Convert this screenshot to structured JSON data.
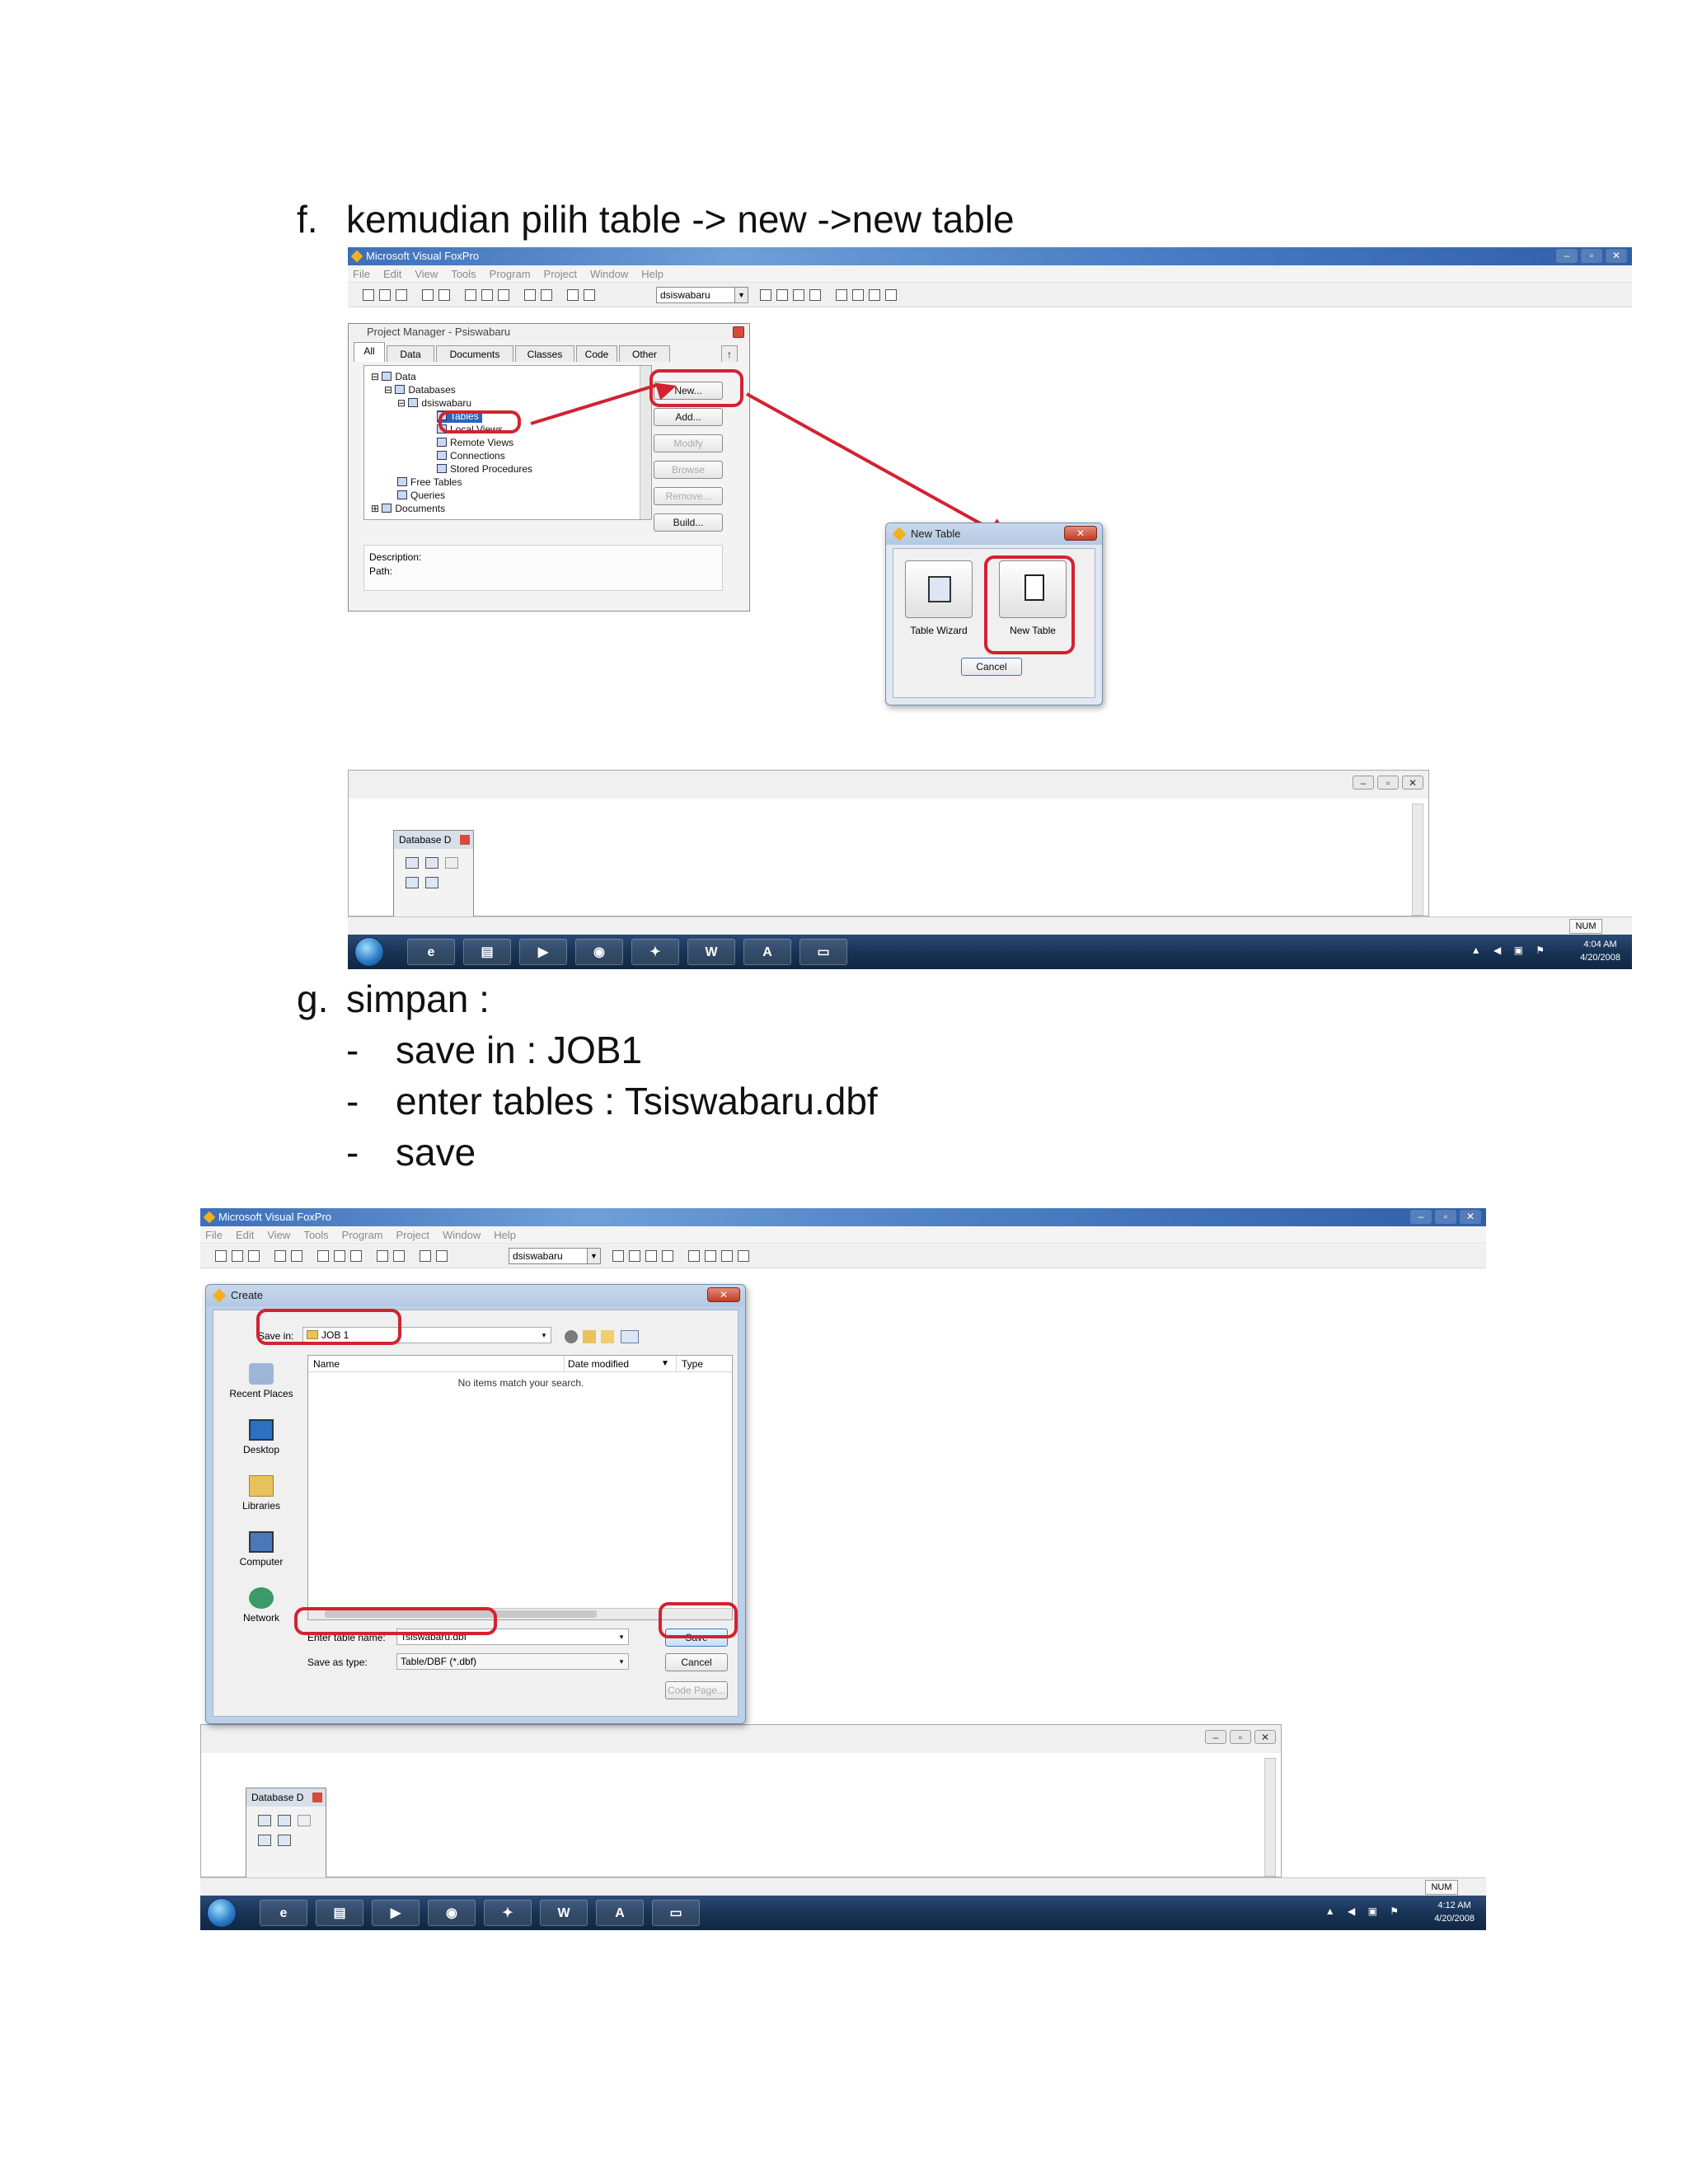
{
  "step_f": {
    "mark": "f.",
    "text": "kemudian pilih table -> new ->new table"
  },
  "step_g": {
    "mark": "g.",
    "text": "simpan :",
    "bullets": [
      "save in : JOB1",
      "enter tables : Tsiswabaru.dbf",
      "save"
    ]
  },
  "shot1": {
    "app_title": "Microsoft Visual FoxPro",
    "menu": [
      "File",
      "Edit",
      "View",
      "Tools",
      "Program",
      "Project",
      "Window",
      "Help"
    ],
    "db_combo": "dsiswabaru",
    "pm_title": "Project Manager - Psiswabaru",
    "tabs": [
      "All",
      "Data",
      "Documents",
      "Classes",
      "Code",
      "Other"
    ],
    "tree": [
      "Data",
      "Databases",
      "dsiswabaru",
      "Tables",
      "Local Views",
      "Remote Views",
      "Connections",
      "Stored Procedures",
      "Free Tables",
      "Queries",
      "Documents"
    ],
    "buttons": [
      "New...",
      "Add...",
      "Modify",
      "Browse",
      "Remove...",
      "Build..."
    ],
    "description_label": "Description:",
    "path_label": "Path:",
    "new_table_dialog": {
      "title": "New Table",
      "wizard_label": "Table Wizard",
      "new_label": "New Table",
      "cancel": "Cancel"
    },
    "db_window_title": "Database D",
    "num": "NUM",
    "clock_time": "4:04 AM",
    "clock_date": "4/20/2008"
  },
  "shot2": {
    "app_title": "Microsoft Visual FoxPro",
    "menu": [
      "File",
      "Edit",
      "View",
      "Tools",
      "Program",
      "Project",
      "Window",
      "Help"
    ],
    "db_combo": "dsiswabaru",
    "create_title": "Create",
    "save_in_label": "Save in:",
    "save_in_value": "JOB 1",
    "col_name": "Name",
    "col_date": "Date modified",
    "col_type": "Type",
    "empty_msg": "No items match your search.",
    "places": [
      "Recent Places",
      "Desktop",
      "Libraries",
      "Computer",
      "Network"
    ],
    "enter_name_label": "Enter table name:",
    "enter_name_value": "Tsiswabaru.dbf",
    "save_type_label": "Save as type:",
    "save_type_value": "Table/DBF (*.dbf)",
    "save_btn": "Save",
    "cancel_btn": "Cancel",
    "codepage_btn": "Code Page...",
    "db_window_title": "Database D",
    "num": "NUM",
    "clock_time": "4:12 AM",
    "clock_date": "4/20/2008"
  },
  "colors": {
    "annotation_red": "#d32230",
    "taskbar": "#183355"
  }
}
